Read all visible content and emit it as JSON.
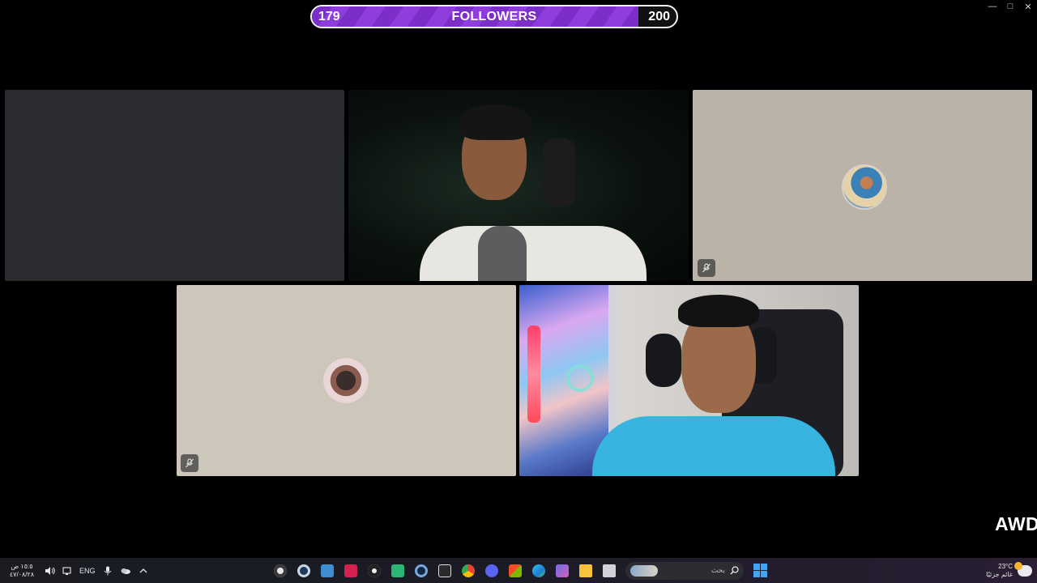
{
  "window": {
    "minimize_icon": "minimize-icon",
    "maximize_icon": "maximize-icon",
    "close_icon": "close-icon"
  },
  "followers_goal": {
    "current": "179",
    "label": "FOLLOWERS",
    "target": "200",
    "progress_fraction": 0.895,
    "fill_color": "#8a35d6"
  },
  "call_tiles": [
    {
      "id": "empty",
      "state": "no-video"
    },
    {
      "id": "cam-top",
      "state": "video"
    },
    {
      "id": "avatar-top-right",
      "state": "avatar",
      "mic": "muted"
    },
    {
      "id": "avatar-bottom-left",
      "state": "avatar",
      "mic": "muted"
    },
    {
      "id": "cam-bottom",
      "state": "video"
    }
  ],
  "watermark": {
    "text": "AWD"
  },
  "taskbar": {
    "clock_time": "١٥:٥ ص",
    "clock_date": "٤٧/٠٨/٢٨",
    "language": "ENG",
    "search_placeholder": "بحث",
    "weather_temp": "23°C",
    "weather_desc": "غائم جزئيًا",
    "apps": [
      "obs",
      "steam",
      "xbox",
      "affinity",
      "steelseries",
      "discord-alt",
      "steam-2",
      "epic",
      "chrome",
      "discord",
      "store",
      "edge",
      "teams",
      "explorer",
      "window-manager"
    ]
  }
}
